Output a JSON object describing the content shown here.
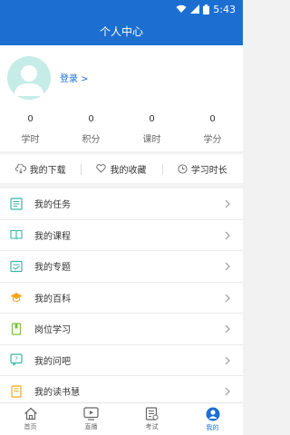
{
  "status": {
    "time": "5:43"
  },
  "header": {
    "title": "个人中心"
  },
  "profile": {
    "login_label": "登录 >"
  },
  "stats": [
    {
      "value": "0",
      "label": "学时"
    },
    {
      "value": "0",
      "label": "积分"
    },
    {
      "value": "0",
      "label": "课时"
    },
    {
      "value": "0",
      "label": "学分"
    }
  ],
  "quick": [
    {
      "label": "我的下载",
      "icon": "cloud-download-icon"
    },
    {
      "label": "我的收藏",
      "icon": "heart-icon"
    },
    {
      "label": "学习时长",
      "icon": "clock-icon"
    }
  ],
  "menu": [
    {
      "label": "我的任务",
      "icon": "task-list-icon"
    },
    {
      "label": "我的课程",
      "icon": "course-book-icon"
    },
    {
      "label": "我的专题",
      "icon": "topic-icon"
    },
    {
      "label": "我的百科",
      "icon": "graduation-cap-icon"
    },
    {
      "label": "岗位学习",
      "icon": "bookmark-icon"
    },
    {
      "label": "我的问吧",
      "icon": "question-bubble-icon"
    },
    {
      "label": "我的读书慧",
      "icon": "reading-book-icon"
    }
  ],
  "tabs": [
    {
      "label": "首页",
      "icon": "home-icon"
    },
    {
      "label": "直播",
      "icon": "live-icon"
    },
    {
      "label": "考试",
      "icon": "exam-icon"
    },
    {
      "label": "我的",
      "icon": "user-icon"
    }
  ],
  "colors": {
    "primary": "#1c6fd1",
    "avatar_bg": "#c6ece7",
    "icon_teal": "#3bb5a6",
    "icon_orange": "#f5a623"
  }
}
